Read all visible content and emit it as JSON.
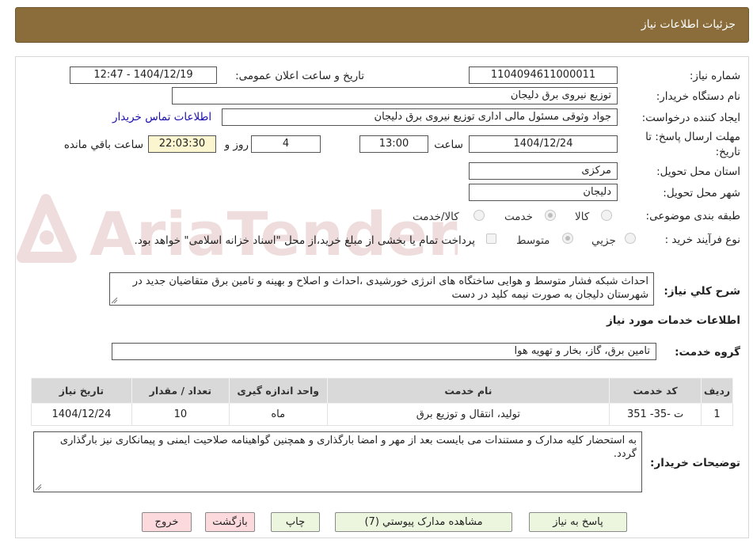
{
  "header": {
    "title": "جزئیات اطلاعات نیاز"
  },
  "info": {
    "need_number_label": "شماره نیاز:",
    "need_number": "1104094611000011",
    "announce_label": "تاریخ و ساعت اعلان عمومی:",
    "announce_value": "1404/12/19 - 12:47",
    "buyer_org_label": "نام دستگاه خریدار:",
    "buyer_org": "توزیع نیروی برق دلیجان",
    "requester_label": "ایجاد کننده درخواست:",
    "requester": "جواد وثوقی مسئول مالی اداری توزیع نیروی برق دلیجان",
    "contact_link": "اطلاعات تماس خریدار",
    "deadline_label_1": "مهلت ارسال پاسخ: تا",
    "deadline_label_2": "تاریخ:",
    "deadline_date": "1404/12/24",
    "time_label": "ساعت",
    "deadline_time": "13:00",
    "days": "4",
    "days_label": "روز و",
    "remaining": "22:03:30",
    "remaining_label": "ساعت باقي مانده",
    "province_label": "استان محل تحویل:",
    "province": "مرکزی",
    "city_label": "شهر محل تحویل:",
    "city": "دلیجان",
    "category_label": "طبقه بندی موضوعی:",
    "category_options": [
      "کالا",
      "خدمت",
      "کالا/خدمت"
    ],
    "process_label": "نوع فرآیند خرید :",
    "process_options": [
      "جزیي",
      "متوسط"
    ],
    "payment_note": "پرداخت تمام یا بخشی از مبلغ خرید،از محل \"اسناد خزانه اسلامی\" خواهد بود."
  },
  "description": {
    "label": "شرح کلي نیاز:",
    "text": "احداث شبکه فشار متوسط و هوایی ساختگاه های  انرژی خورشیدی ،احداث و  اصلاح و بهینه و تامین برق متقاضیان جدید در شهرستان دلیجان به صورت نیمه کلید در دست"
  },
  "services": {
    "section_title": "اطلاعات خدمات مورد نیاز",
    "group_label": "گروه خدمت:",
    "group_value": "تامین برق، گاز، بخار و تهویه هوا",
    "columns": [
      "ردیف",
      "کد خدمت",
      "نام خدمت",
      "واحد اندازه گیری",
      "تعداد / مقدار",
      "تاریخ نیاز"
    ],
    "rows": [
      [
        "1",
        "ت -35- 351",
        "تولید، انتقال و توزیع برق",
        "ماه",
        "10",
        "1404/12/24"
      ]
    ]
  },
  "buyer_notes": {
    "label": "توضیحات خریدار:",
    "text": "به استحضار کلیه مدارک و مستندات می بایست  بعد از مهر و امضا بارگذاری و همچنین گواهینامه صلاحیت ایمنی و پیمانکاری نیز بارگذاری گردد."
  },
  "buttons": {
    "reply": "پاسخ به نیاز",
    "attachments": "مشاهده مدارک پیوستي (7)",
    "print": "چاپ",
    "back": "بازگشت",
    "exit": "خروج"
  },
  "watermark": {
    "text": "AriaTender.neT"
  },
  "colors": {
    "header_bg": "#8a6d3b",
    "yellow_box": "#fbf6cf",
    "link": "#1a0dab",
    "btn_green": "#ecf5de",
    "btn_pink": "#fbd9dd"
  }
}
